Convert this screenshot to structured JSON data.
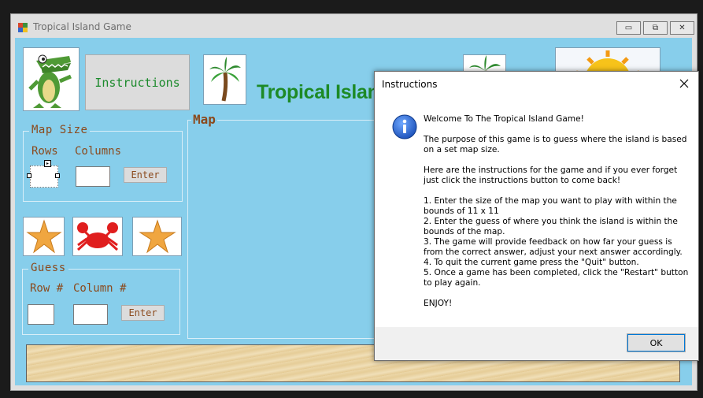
{
  "window": {
    "title": "Tropical Island Game",
    "controls": {
      "minimize": "▭",
      "maximize": "⧉",
      "close": "✕"
    }
  },
  "header": {
    "instructions_button": "Instructions",
    "title_visible": "Tropical Island Gam"
  },
  "map_size": {
    "legend": "Map Size",
    "rows_label": "Rows",
    "columns_label": "Columns",
    "rows_value": "",
    "columns_value": "",
    "enter_button": "Enter"
  },
  "map": {
    "legend": "Map"
  },
  "guess": {
    "legend": "Guess",
    "row_label": "Row #",
    "column_label": "Column #",
    "row_value": "",
    "column_value": "",
    "enter_button": "Enter"
  },
  "dialog": {
    "title": "Instructions",
    "close_glyph": "✕",
    "welcome": "Welcome To The Tropical Island Game!",
    "purpose": "The purpose of this game is to guess where the island is based on a set map size.",
    "intro": "Here are the instructions for the game and if you ever forget just click the instructions button to come back!",
    "steps": [
      "1. Enter the size of the map you want to play with within the bounds of 11 x 11",
      "2. Enter the guess of where you think the island is within the bounds of the map.",
      "3. The game will provide feedback on how far your guess is from the correct answer, adjust your next answer accordingly.",
      "4. To quit the current game press the \"Quit\" button.",
      "5. Once a game has been completed, click the \"Restart\" button to play again."
    ],
    "closing": "ENJOY!",
    "ok_button": "OK"
  },
  "colors": {
    "client_bg": "#87ceeb",
    "title_green": "#1d8a26",
    "label_brown": "#8b4a1d",
    "info_blue": "#1c5fbf"
  },
  "icons": {
    "crocodile": "crocodile-image",
    "palm": "palm-tree-image",
    "sun": "sun-image",
    "starfish": "starfish-image",
    "crab": "crab-image",
    "sand": "sand-image",
    "info": "info-icon"
  }
}
